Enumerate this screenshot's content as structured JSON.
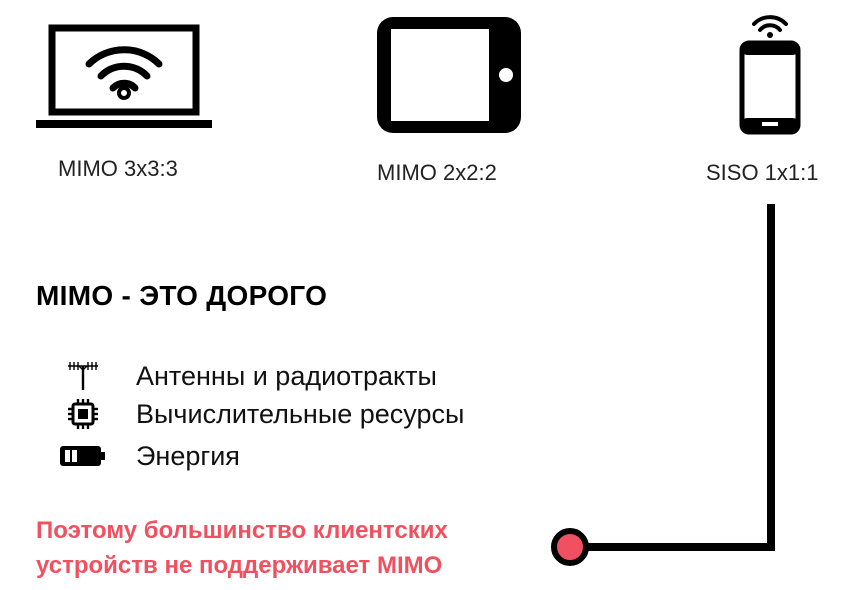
{
  "devices": [
    {
      "icon": "laptop-wifi-icon",
      "label": "MIMO 3x3:3"
    },
    {
      "icon": "tablet-icon",
      "label": "MIMO 2x2:2"
    },
    {
      "icon": "smartphone-wifi-icon",
      "label": "SISO 1x1:1"
    }
  ],
  "headline": "MIMO - ЭТО ДОРОГО",
  "costs": [
    {
      "icon": "antenna-icon",
      "label": "Антенны и радиотракты"
    },
    {
      "icon": "cpu-chip-icon",
      "label": "Вычислительные ресурсы"
    },
    {
      "icon": "battery-icon",
      "label": "Энергия"
    }
  ],
  "conclusion": {
    "line1": "Поэтому большинство клиентских",
    "line2": "устройств не поддерживает MIMO"
  },
  "colors": {
    "accent": "#f0505f",
    "ink": "#000000",
    "text": "#222222"
  }
}
